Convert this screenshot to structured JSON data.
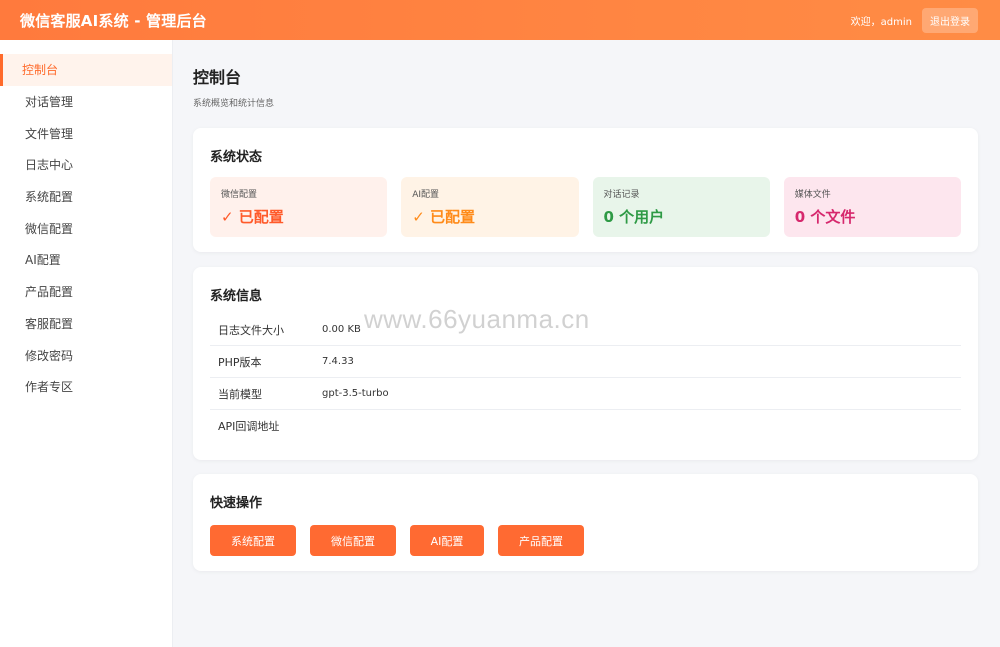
{
  "header": {
    "title": "微信客服AI系统 - 管理后台",
    "welcome": "欢迎，admin",
    "logout_label": "退出登录"
  },
  "sidebar": {
    "items": [
      {
        "label": "控制台",
        "active": true
      },
      {
        "label": "对话管理"
      },
      {
        "label": "文件管理"
      },
      {
        "label": "日志中心"
      },
      {
        "label": "系统配置"
      },
      {
        "label": "微信配置"
      },
      {
        "label": "AI配置"
      },
      {
        "label": "产品配置"
      },
      {
        "label": "客服配置"
      },
      {
        "label": "修改密码"
      },
      {
        "label": "作者专区"
      }
    ]
  },
  "page": {
    "title": "控制台",
    "subtitle": "系统概览和统计信息"
  },
  "status": {
    "heading": "系统状态",
    "cards": [
      {
        "label": "微信配置",
        "value": "✓ 已配置",
        "color": "#ff5a2a"
      },
      {
        "label": "AI配置",
        "value": "✓ 已配置",
        "color": "#ff8b1a"
      },
      {
        "label": "对话记录",
        "value": "0 个用户",
        "color": "#2e9a45"
      },
      {
        "label": "媒体文件",
        "value": "0 个文件",
        "color": "#d6286d"
      }
    ]
  },
  "info": {
    "heading": "系统信息",
    "rows": [
      {
        "key": "日志文件大小",
        "value": "0.00 KB"
      },
      {
        "key": "PHP版本",
        "value": "7.4.33"
      },
      {
        "key": "当前模型",
        "value": "gpt-3.5-turbo"
      },
      {
        "key": "API回调地址",
        "value": ""
      }
    ]
  },
  "quick_actions": {
    "heading": "快速操作",
    "buttons": [
      "系统配置",
      "微信配置",
      "AI配置",
      "产品配置"
    ]
  },
  "watermark": "www.66yuanma.cn",
  "colors": {
    "accent": "#ff6a32",
    "topbar": "#ff7a3d"
  }
}
